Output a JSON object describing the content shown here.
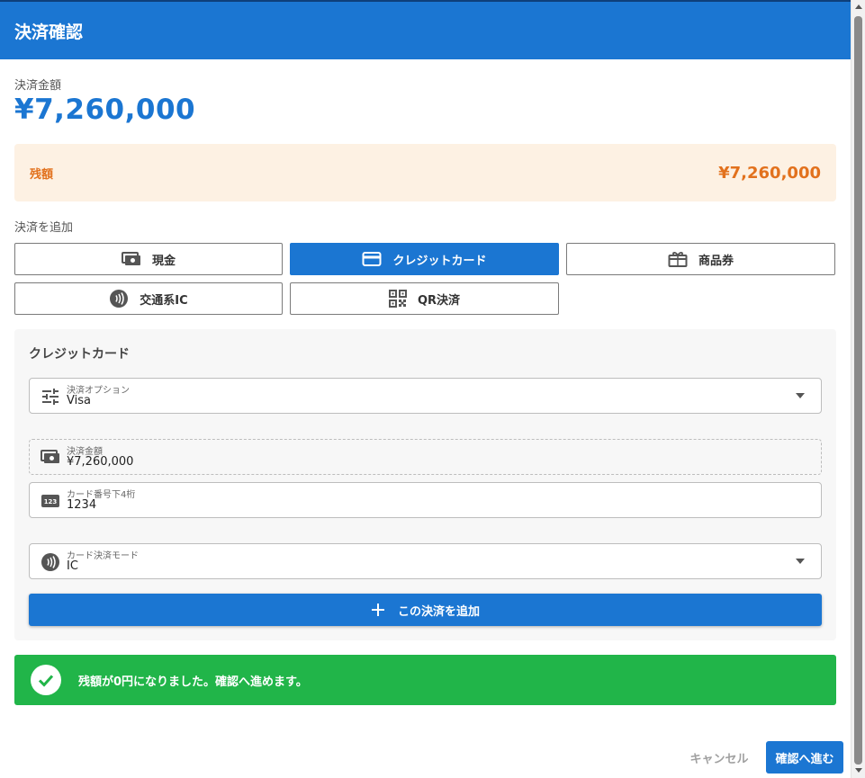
{
  "dialog": {
    "title": "決済確認",
    "amount_label": "決済金額",
    "amount_value": "¥7,260,000",
    "remaining_label": "残額",
    "remaining_value": "¥7,260,000",
    "add_payment_label": "決済を追加"
  },
  "methods": [
    {
      "label": "現金",
      "icon": "cash-icon",
      "selected": false
    },
    {
      "label": "クレジットカード",
      "icon": "credit-card-icon",
      "selected": true
    },
    {
      "label": "商品券",
      "icon": "gift-icon",
      "selected": false
    },
    {
      "label": "交通系IC",
      "icon": "contactless-icon",
      "selected": false
    },
    {
      "label": "QR決済",
      "icon": "qr-code-icon",
      "selected": false
    }
  ],
  "panel": {
    "title": "クレジットカード",
    "option_label": "決済オプション",
    "option_value": "Visa",
    "amount_label": "決済金額",
    "amount_value": "¥7,260,000",
    "card_last4_label": "カード番号下4桁",
    "card_last4_value": "1234",
    "mode_label": "カード決済モード",
    "mode_value": "IC",
    "add_button": "この決済を追加"
  },
  "status": {
    "message": "残額が0円になりました。確認へ進めます。"
  },
  "footer": {
    "cancel": "キャンセル",
    "confirm": "確認へ進む"
  },
  "colors": {
    "primary": "#1b76d2",
    "remaining_bg": "#fdf1e3",
    "remaining_text": "#e2711d",
    "success": "#21b549"
  }
}
